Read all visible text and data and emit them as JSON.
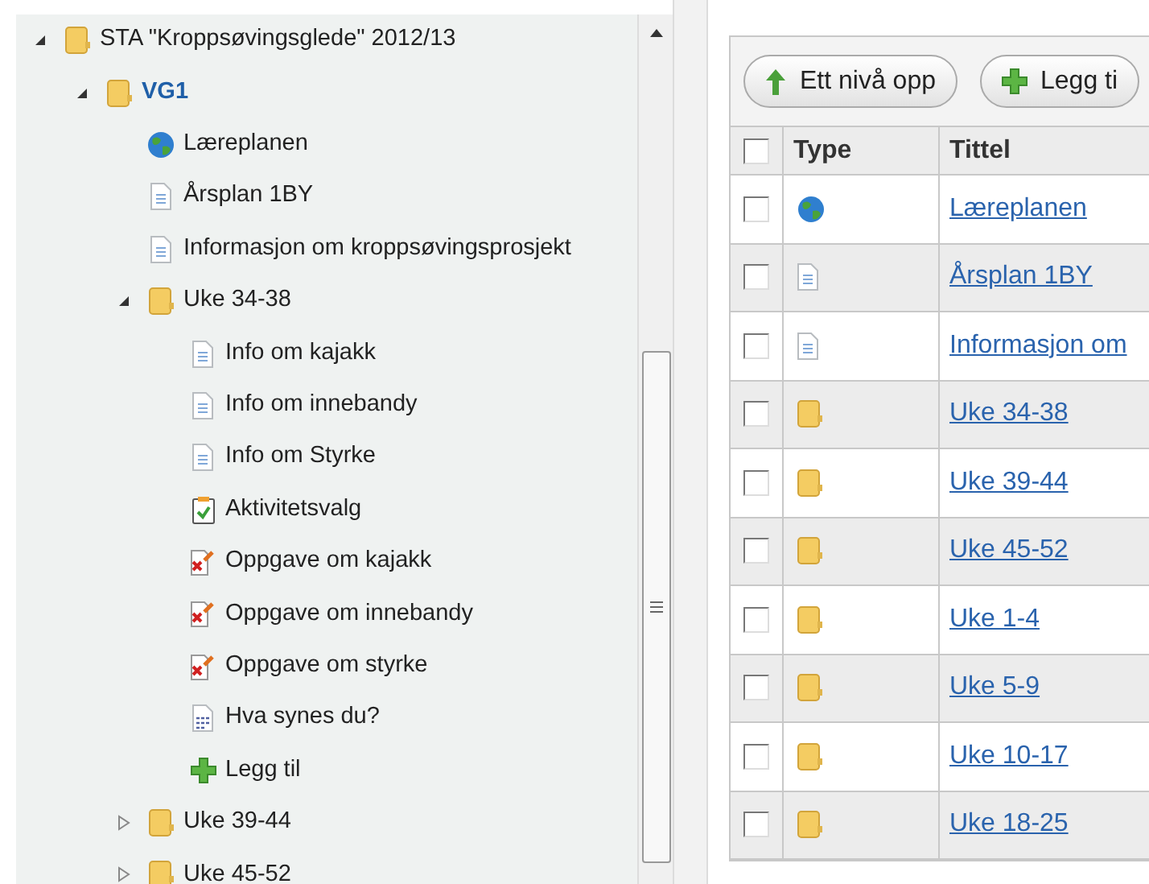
{
  "tree": [
    {
      "label": "STA \"Kroppsøvingsglede\" 2012/13",
      "kind": "folder",
      "expanded": true,
      "selected": false,
      "children": [
        {
          "label": "VG1",
          "kind": "folder",
          "expanded": true,
          "selected": true,
          "children": [
            {
              "label": "Læreplanen",
              "kind": "globe",
              "selected": false
            },
            {
              "label": "Årsplan 1BY",
              "kind": "document",
              "selected": false
            },
            {
              "label": "Informasjon om kroppsøvingsprosjekt",
              "kind": "document",
              "selected": false
            },
            {
              "label": "Uke 34-38",
              "kind": "folder",
              "expanded": true,
              "selected": false,
              "children": [
                {
                  "label": "Info om kajakk",
                  "kind": "document",
                  "selected": false
                },
                {
                  "label": "Info om innebandy",
                  "kind": "document",
                  "selected": false
                },
                {
                  "label": "Info om Styrke",
                  "kind": "document",
                  "selected": false
                },
                {
                  "label": "Aktivitetsvalg",
                  "kind": "task",
                  "selected": false
                },
                {
                  "label": "Oppgave om kajakk",
                  "kind": "assignment",
                  "selected": false
                },
                {
                  "label": "Oppgave om innebandy",
                  "kind": "assignment",
                  "selected": false
                },
                {
                  "label": "Oppgave om styrke",
                  "kind": "assignment",
                  "selected": false
                },
                {
                  "label": "Hva synes du?",
                  "kind": "survey",
                  "selected": false
                },
                {
                  "label": "Legg til",
                  "kind": "add",
                  "selected": false
                }
              ]
            },
            {
              "label": "Uke 39-44",
              "kind": "folder",
              "expanded": false,
              "selected": false
            },
            {
              "label": "Uke 45-52",
              "kind": "folder",
              "expanded": false,
              "selected": false
            }
          ]
        }
      ]
    }
  ],
  "toolbar": [
    {
      "label": "Ett nivå opp",
      "kind": "up"
    },
    {
      "label": "Legg ti",
      "kind": "add"
    }
  ],
  "table": {
    "header_checked": false,
    "columns": [
      "Type",
      "Tittel"
    ],
    "rows": [
      {
        "kind": "globe",
        "title": "Læreplanen",
        "checked": false
      },
      {
        "kind": "document",
        "title": "Årsplan 1BY",
        "checked": false
      },
      {
        "kind": "document",
        "title": "Informasjon om",
        "checked": false
      },
      {
        "kind": "folder",
        "title": "Uke 34-38",
        "checked": false
      },
      {
        "kind": "folder",
        "title": "Uke 39-44",
        "checked": false
      },
      {
        "kind": "folder",
        "title": "Uke 45-52",
        "checked": false
      },
      {
        "kind": "folder",
        "title": "Uke 1-4",
        "checked": false
      },
      {
        "kind": "folder",
        "title": "Uke 5-9",
        "checked": false
      },
      {
        "kind": "folder",
        "title": "Uke 10-17",
        "checked": false
      },
      {
        "kind": "folder",
        "title": "Uke 18-25",
        "checked": false
      }
    ]
  }
}
